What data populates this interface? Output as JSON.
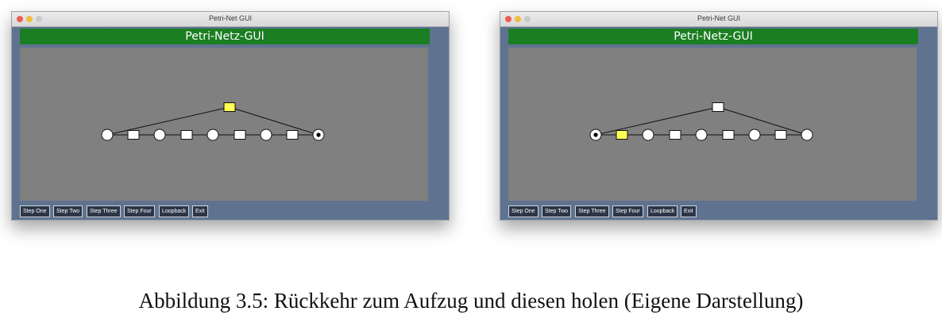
{
  "windows": [
    {
      "title": "Petri-Net GUI",
      "header": "Petri-Netz-GUI",
      "buttons": [
        "Step One",
        "Step Two",
        "Step Three",
        "Step Four",
        "Loopback",
        "Exit"
      ],
      "net": {
        "places": [
          {
            "token": false
          },
          {
            "token": false
          },
          {
            "token": false
          },
          {
            "token": false
          },
          {
            "token": true
          }
        ],
        "transitions": [
          {
            "active": false
          },
          {
            "active": false
          },
          {
            "active": false
          },
          {
            "active": false
          }
        ],
        "loopback_transition": {
          "active": true
        }
      }
    },
    {
      "title": "Petri-Net GUI",
      "header": "Petri-Netz-GUI",
      "buttons": [
        "Step One",
        "Step Two",
        "Step Three",
        "Step Four",
        "Loopback",
        "Exit"
      ],
      "net": {
        "places": [
          {
            "token": true
          },
          {
            "token": false
          },
          {
            "token": false
          },
          {
            "token": false
          },
          {
            "token": false
          }
        ],
        "transitions": [
          {
            "active": true
          },
          {
            "active": false
          },
          {
            "active": false
          },
          {
            "active": false
          }
        ],
        "loopback_transition": {
          "active": false
        }
      }
    }
  ],
  "colors": {
    "active_transition": "#ffff55",
    "inactive_transition": "#ffffff",
    "canvas": "#808080",
    "header": "#1b7e22"
  },
  "caption": "Abbildung 3.5: Rückkehr zum Aufzug und diesen holen (Eigene Darstellung)"
}
